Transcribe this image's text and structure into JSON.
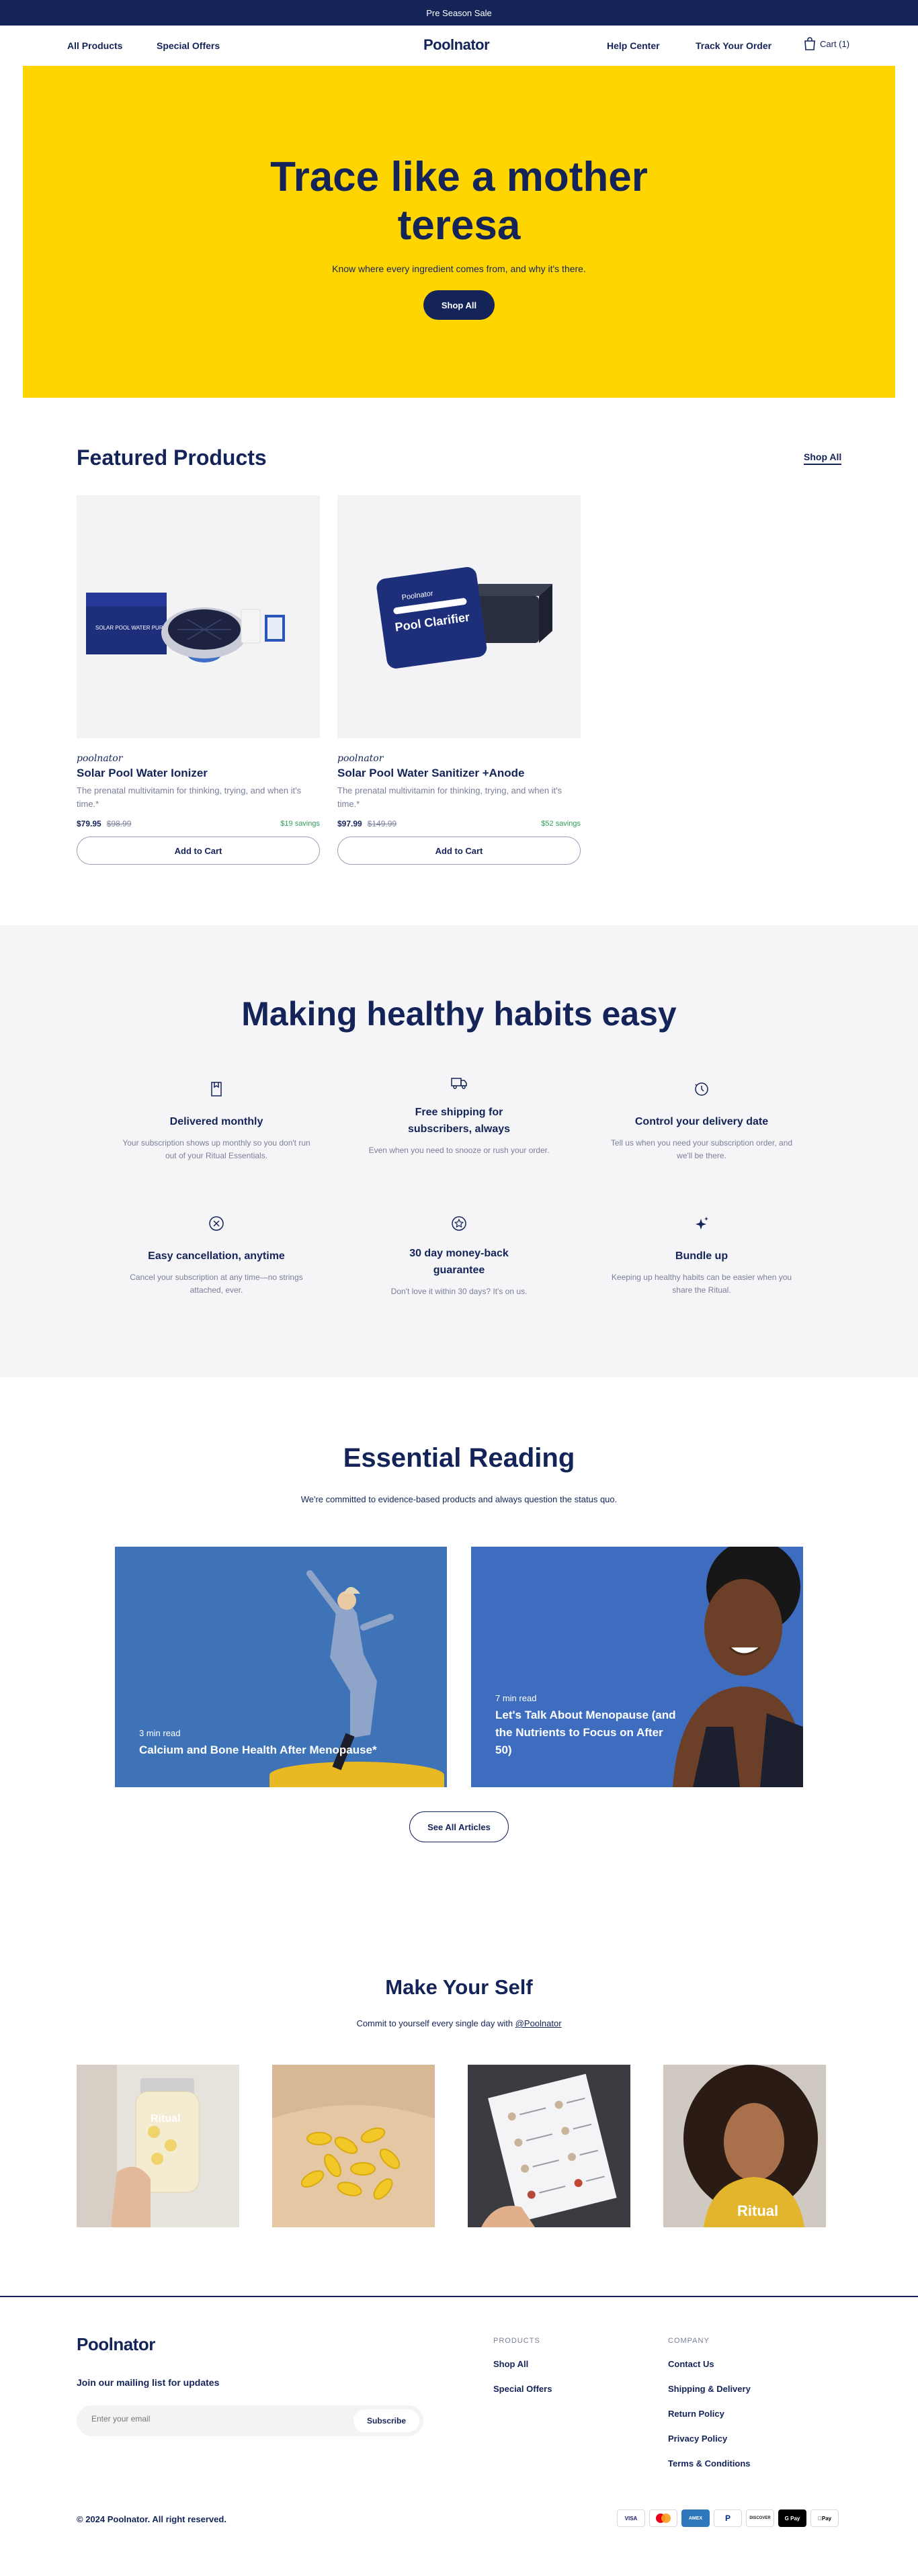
{
  "announcement": "Pre Season Sale",
  "header": {
    "nav_left": [
      "All Products",
      "Special Offers"
    ],
    "logo": "Poolnator",
    "nav_right": [
      "Help Center",
      "Track Your Order"
    ],
    "cart_label": "Cart (1)"
  },
  "hero": {
    "title": "Trace like a mother teresa",
    "subtitle": "Know where every ingredient comes from, and why it's there.",
    "button": "Shop All",
    "background_color": "#FFD500"
  },
  "featured": {
    "title": "Featured Products",
    "shop_all": "Shop All",
    "products": [
      {
        "brand": "poolnator",
        "name": "Solar Pool Water Ionizer",
        "description": "The prenatal multivitamin for thinking, trying, and when it's time.*",
        "price": "$79.95",
        "old_price": "$98.99",
        "savings": "$19 savings",
        "button": "Add to Cart",
        "box_text": "SOLAR POOL WATER PURIFIER"
      },
      {
        "brand": "poolnator",
        "name": "Solar Pool Water Sanitizer +Anode",
        "description": "The prenatal multivitamin for thinking, trying, and when it's time.*",
        "price": "$97.99",
        "old_price": "$149.99",
        "savings": "$52 savings",
        "button": "Add to Cart",
        "box_brand": "Poolnator",
        "box_text": "Pool Clarifier"
      }
    ]
  },
  "habits": {
    "title": "Making healthy habits easy",
    "items": [
      {
        "icon": "package-icon",
        "title": "Delivered monthly",
        "desc": "Your subscription shows up monthly so you don't run out of your Ritual Essentials."
      },
      {
        "icon": "truck-icon",
        "title": "Free shipping for subscribers, always",
        "desc": "Even when you need to snooze or rush your order."
      },
      {
        "icon": "clock-icon",
        "title": "Control your delivery date",
        "desc": "Tell us when you need your subscription order, and we'll be there."
      },
      {
        "icon": "cancel-icon",
        "title": "Easy cancellation, anytime",
        "desc": "Cancel your subscription at any time—no strings attached, ever."
      },
      {
        "icon": "star-badge-icon",
        "title": "30 day money-back guarantee",
        "desc": "Don't love it within 30 days? It's on us."
      },
      {
        "icon": "sparkle-icon",
        "title": "Bundle up",
        "desc": "Keeping up healthy habits can be easier when you share the Ritual."
      }
    ]
  },
  "reading": {
    "title": "Essential Reading",
    "subtitle": "We're committed to evidence-based products and always question the status quo.",
    "articles": [
      {
        "meta": "3 min read",
        "title": "Calcium and Bone Health After Menopause*"
      },
      {
        "meta": "7 min read",
        "title": "Let's Talk About Menopause (and the Nutrients to Focus on After 50)"
      }
    ],
    "button": "See All Articles"
  },
  "social": {
    "title": "Make Your Self",
    "subtitle_prefix": "Commit to yourself every single day with ",
    "handle": "@Poolnator",
    "tile_texts": [
      "Ritual",
      "Ritual"
    ]
  },
  "footer": {
    "logo": "Poolnator",
    "mailing_title": "Join our mailing list for updates",
    "email_placeholder": "Enter your email",
    "subscribe": "Subscribe",
    "products_heading": "PRODUCTS",
    "products_links": [
      "Shop All",
      "Special Offers"
    ],
    "company_heading": "COMPANY",
    "company_links": [
      "Contact Us",
      "Shipping & Delivery",
      "Return Policy",
      "Privacy Policy",
      "Terms & Conditions"
    ],
    "copyright": "© 2024 Poolnator. All right reserved.",
    "payments": [
      "VISA",
      "Mastercard",
      "AMEX",
      "PayPal",
      "DISCOVER",
      "G Pay",
      "Apple Pay"
    ]
  },
  "colors": {
    "navy": "#142459",
    "yellow": "#FFD500",
    "savings_green": "#2F9E5A",
    "light_bg": "#F5F5F8"
  }
}
